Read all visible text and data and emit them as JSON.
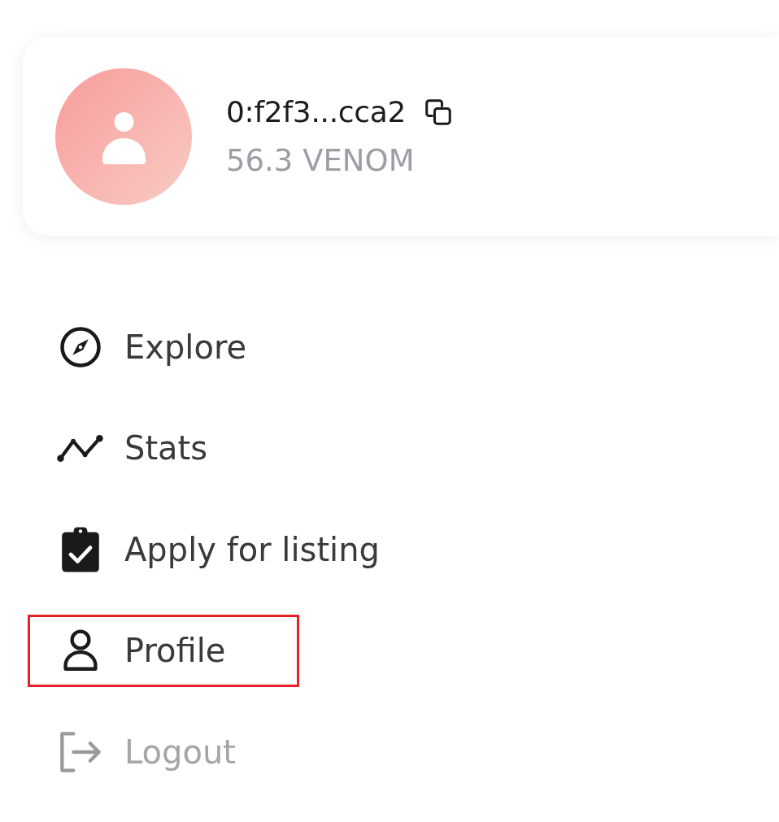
{
  "profile_card": {
    "address": "0:f2f3...cca2",
    "balance": "56.3 VENOM"
  },
  "menu": {
    "items": [
      {
        "label": "Explore",
        "highlighted": false,
        "dimmed": false
      },
      {
        "label": "Stats",
        "highlighted": false,
        "dimmed": false
      },
      {
        "label": "Apply for listing",
        "highlighted": false,
        "dimmed": false
      },
      {
        "label": "Profile",
        "highlighted": true,
        "dimmed": false
      },
      {
        "label": "Logout",
        "highlighted": false,
        "dimmed": true
      }
    ]
  }
}
